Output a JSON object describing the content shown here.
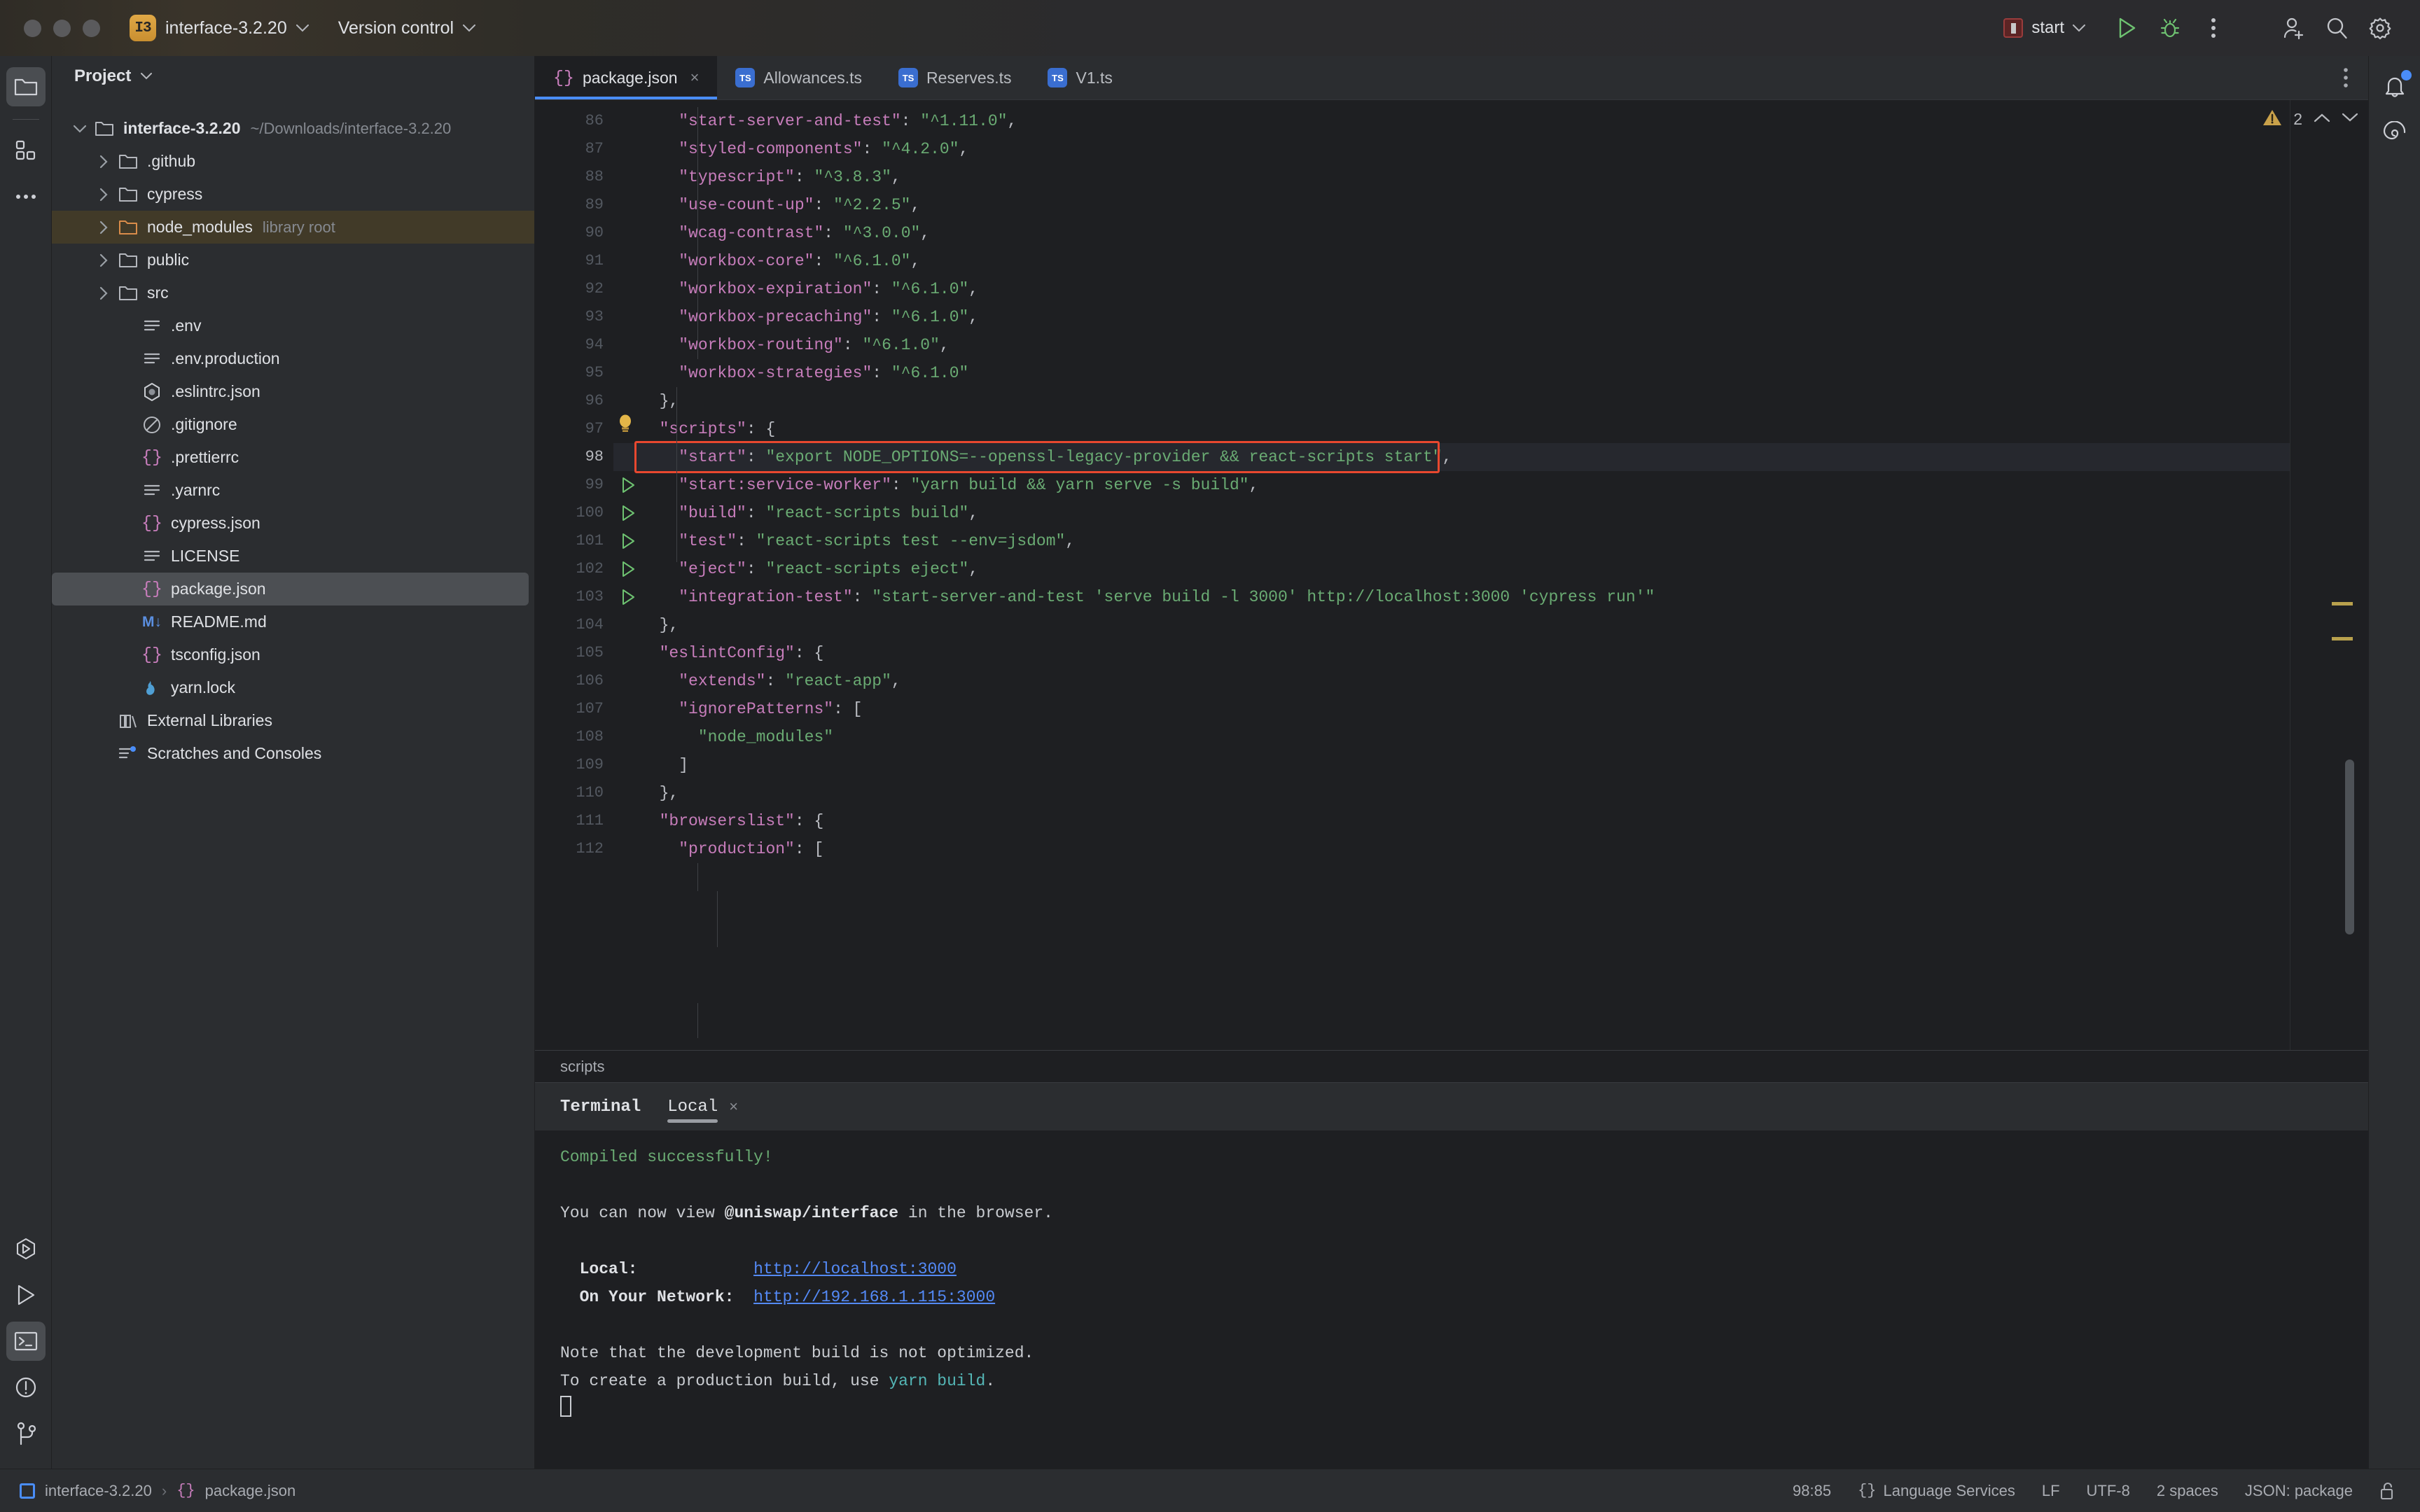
{
  "titlebar": {
    "project_badge": "I3",
    "project_name": "interface-3.2.20",
    "vcs_label": "Version control",
    "run_config": "start",
    "icons": [
      "run-icon",
      "debug-icon",
      "more-actions-icon",
      "add-user-icon",
      "search-icon",
      "settings-gear-icon"
    ]
  },
  "left_rail": {
    "items": [
      {
        "name": "project-tool-window",
        "icon": "folder-icon",
        "active": true
      },
      {
        "name": "structure-tool-window",
        "icon": "grid-modules-icon",
        "active": false
      },
      {
        "name": "more-tool-windows",
        "icon": "ellipsis-icon",
        "active": false
      }
    ],
    "bottom_items": [
      {
        "name": "services-tool-window",
        "icon": "hexagon-play-icon",
        "active": false
      },
      {
        "name": "run-tool-window",
        "icon": "play-triangle-icon",
        "active": false
      },
      {
        "name": "terminal-tool-window",
        "icon": "terminal-prompt-icon",
        "active": true
      },
      {
        "name": "problems-tool-window",
        "icon": "exclamation-circle-icon",
        "active": false
      },
      {
        "name": "version-control-tool-window",
        "icon": "git-branch-icon",
        "active": false
      }
    ]
  },
  "project_panel": {
    "title": "Project",
    "tree": [
      {
        "label": "interface-3.2.20",
        "hint": "~/Downloads/interface-3.2.20",
        "icon": "folder-icon",
        "indent": 0,
        "twisty": "down",
        "bold": true,
        "selected": ""
      },
      {
        "label": ".github",
        "hint": "",
        "icon": "folder-icon",
        "indent": 1,
        "twisty": "right",
        "bold": false,
        "selected": ""
      },
      {
        "label": "cypress",
        "hint": "",
        "icon": "folder-icon",
        "indent": 1,
        "twisty": "right",
        "bold": false,
        "selected": ""
      },
      {
        "label": "node_modules",
        "hint": "library root",
        "icon": "folder-orange-icon",
        "indent": 1,
        "twisty": "right",
        "bold": false,
        "selected": "amber"
      },
      {
        "label": "public",
        "hint": "",
        "icon": "folder-icon",
        "indent": 1,
        "twisty": "right",
        "bold": false,
        "selected": ""
      },
      {
        "label": "src",
        "hint": "",
        "icon": "folder-icon",
        "indent": 1,
        "twisty": "right",
        "bold": false,
        "selected": ""
      },
      {
        "label": ".env",
        "hint": "",
        "icon": "text-file-icon",
        "indent": 2,
        "twisty": "",
        "bold": false,
        "selected": ""
      },
      {
        "label": ".env.production",
        "hint": "",
        "icon": "text-file-icon",
        "indent": 2,
        "twisty": "",
        "bold": false,
        "selected": ""
      },
      {
        "label": ".eslintrc.json",
        "hint": "",
        "icon": "eslint-icon",
        "indent": 2,
        "twisty": "",
        "bold": false,
        "selected": ""
      },
      {
        "label": ".gitignore",
        "hint": "",
        "icon": "gitignore-icon",
        "indent": 2,
        "twisty": "",
        "bold": false,
        "selected": ""
      },
      {
        "label": ".prettierrc",
        "hint": "",
        "icon": "json-braces-icon",
        "indent": 2,
        "twisty": "",
        "bold": false,
        "selected": ""
      },
      {
        "label": ".yarnrc",
        "hint": "",
        "icon": "text-file-icon",
        "indent": 2,
        "twisty": "",
        "bold": false,
        "selected": ""
      },
      {
        "label": "cypress.json",
        "hint": "",
        "icon": "json-braces-icon",
        "indent": 2,
        "twisty": "",
        "bold": false,
        "selected": ""
      },
      {
        "label": "LICENSE",
        "hint": "",
        "icon": "text-file-icon",
        "indent": 2,
        "twisty": "",
        "bold": false,
        "selected": ""
      },
      {
        "label": "package.json",
        "hint": "",
        "icon": "json-braces-icon",
        "indent": 2,
        "twisty": "",
        "bold": false,
        "selected": "grey"
      },
      {
        "label": "README.md",
        "hint": "",
        "icon": "markdown-icon",
        "indent": 2,
        "twisty": "",
        "bold": false,
        "selected": ""
      },
      {
        "label": "tsconfig.json",
        "hint": "",
        "icon": "json-braces-icon",
        "indent": 2,
        "twisty": "",
        "bold": false,
        "selected": ""
      },
      {
        "label": "yarn.lock",
        "hint": "",
        "icon": "yarn-cat-icon",
        "indent": 2,
        "twisty": "",
        "bold": false,
        "selected": ""
      },
      {
        "label": "External Libraries",
        "hint": "",
        "icon": "libraries-icon",
        "indent": 1,
        "twisty": "",
        "bold": false,
        "selected": ""
      },
      {
        "label": "Scratches and Consoles",
        "hint": "",
        "icon": "scratches-icon",
        "indent": 1,
        "twisty": "",
        "bold": false,
        "selected": ""
      }
    ]
  },
  "editor": {
    "tabs": [
      {
        "label": "package.json",
        "icon": "json-braces-icon",
        "active": true,
        "closable": true
      },
      {
        "label": "Allowances.ts",
        "icon": "ts-icon",
        "active": false,
        "closable": false
      },
      {
        "label": "Reserves.ts",
        "icon": "ts-icon",
        "active": false,
        "closable": false
      },
      {
        "label": "V1.ts",
        "icon": "ts-icon",
        "active": false,
        "closable": false
      }
    ],
    "warning_count": "2",
    "breadcrumb": "scripts",
    "current_line": 98,
    "highlight_line": 98,
    "first_line_number": 86,
    "lines": [
      {
        "n": 86,
        "indent": 4,
        "key": "\"start-server-and-test\"",
        "val": "\"^1.11.0\"",
        "comma": true,
        "raw": "",
        "gutter": ""
      },
      {
        "n": 87,
        "indent": 4,
        "key": "\"styled-components\"",
        "val": "\"^4.2.0\"",
        "comma": true,
        "raw": "",
        "gutter": ""
      },
      {
        "n": 88,
        "indent": 4,
        "key": "\"typescript\"",
        "val": "\"^3.8.3\"",
        "comma": true,
        "raw": "",
        "gutter": ""
      },
      {
        "n": 89,
        "indent": 4,
        "key": "\"use-count-up\"",
        "val": "\"^2.2.5\"",
        "comma": true,
        "raw": "",
        "gutter": ""
      },
      {
        "n": 90,
        "indent": 4,
        "key": "\"wcag-contrast\"",
        "val": "\"^3.0.0\"",
        "comma": true,
        "raw": "",
        "gutter": ""
      },
      {
        "n": 91,
        "indent": 4,
        "key": "\"workbox-core\"",
        "val": "\"^6.1.0\"",
        "comma": true,
        "raw": "",
        "gutter": ""
      },
      {
        "n": 92,
        "indent": 4,
        "key": "\"workbox-expiration\"",
        "val": "\"^6.1.0\"",
        "comma": true,
        "raw": "",
        "gutter": ""
      },
      {
        "n": 93,
        "indent": 4,
        "key": "\"workbox-precaching\"",
        "val": "\"^6.1.0\"",
        "comma": true,
        "raw": "",
        "gutter": ""
      },
      {
        "n": 94,
        "indent": 4,
        "key": "\"workbox-routing\"",
        "val": "\"^6.1.0\"",
        "comma": true,
        "raw": "",
        "gutter": ""
      },
      {
        "n": 95,
        "indent": 4,
        "key": "\"workbox-strategies\"",
        "val": "\"^6.1.0\"",
        "comma": false,
        "raw": "",
        "gutter": ""
      },
      {
        "n": 96,
        "indent": 2,
        "key": "",
        "val": "",
        "comma": false,
        "raw": "},",
        "gutter": ""
      },
      {
        "n": 97,
        "indent": 2,
        "key": "\"scripts\"",
        "val": "",
        "comma": false,
        "raw": "",
        "open": "{",
        "gutter": "bulb"
      },
      {
        "n": 98,
        "indent": 4,
        "key": "\"start\"",
        "val": "\"export NODE_OPTIONS=--openssl-legacy-provider && react-scripts start\"",
        "comma": true,
        "raw": "",
        "gutter": "run"
      },
      {
        "n": 99,
        "indent": 4,
        "key": "\"start:service-worker\"",
        "val": "\"yarn build && yarn serve -s build\"",
        "comma": true,
        "raw": "",
        "gutter": "run"
      },
      {
        "n": 100,
        "indent": 4,
        "key": "\"build\"",
        "val": "\"react-scripts build\"",
        "comma": true,
        "raw": "",
        "gutter": "run"
      },
      {
        "n": 101,
        "indent": 4,
        "key": "\"test\"",
        "val": "\"react-scripts test --env=jsdom\"",
        "comma": true,
        "raw": "",
        "gutter": "run"
      },
      {
        "n": 102,
        "indent": 4,
        "key": "\"eject\"",
        "val": "\"react-scripts eject\"",
        "comma": true,
        "raw": "",
        "gutter": "run"
      },
      {
        "n": 103,
        "indent": 4,
        "key": "\"integration-test\"",
        "val": "\"start-server-and-test 'serve build -l 3000' http://localhost:3000 'cypress run'\"",
        "comma": false,
        "raw": "",
        "gutter": "run"
      },
      {
        "n": 104,
        "indent": 2,
        "key": "",
        "val": "",
        "comma": false,
        "raw": "},",
        "gutter": ""
      },
      {
        "n": 105,
        "indent": 2,
        "key": "\"eslintConfig\"",
        "val": "",
        "comma": false,
        "raw": "",
        "open": "{",
        "gutter": ""
      },
      {
        "n": 106,
        "indent": 4,
        "key": "\"extends\"",
        "val": "\"react-app\"",
        "comma": true,
        "raw": "",
        "gutter": ""
      },
      {
        "n": 107,
        "indent": 4,
        "key": "\"ignorePatterns\"",
        "val": "",
        "comma": false,
        "raw": "",
        "open": "[",
        "gutter": ""
      },
      {
        "n": 108,
        "indent": 6,
        "key": "",
        "val": "\"node_modules\"",
        "comma": false,
        "raw": "",
        "gutter": ""
      },
      {
        "n": 109,
        "indent": 4,
        "key": "",
        "val": "",
        "comma": false,
        "raw": "]",
        "gutter": ""
      },
      {
        "n": 110,
        "indent": 2,
        "key": "",
        "val": "",
        "comma": false,
        "raw": "},",
        "gutter": ""
      },
      {
        "n": 111,
        "indent": 2,
        "key": "\"browserslist\"",
        "val": "",
        "comma": false,
        "raw": "",
        "open": "{",
        "gutter": ""
      },
      {
        "n": 112,
        "indent": 4,
        "key": "\"production\"",
        "val": "",
        "comma": false,
        "raw": "",
        "open": "[",
        "gutter": ""
      }
    ]
  },
  "terminal": {
    "title": "Terminal",
    "local_tab": "Local",
    "close_glyph": "×",
    "lines": [
      {
        "type": "green",
        "text": "Compiled successfully!"
      },
      {
        "type": "blank",
        "text": ""
      },
      {
        "type": "mixed-bold",
        "pre": "You can now view ",
        "bold": "@uniswap/interface",
        "post": " in the browser."
      },
      {
        "type": "blank",
        "text": ""
      },
      {
        "type": "link",
        "label": "  Local:",
        "pad": "            ",
        "url": "http://localhost:3000"
      },
      {
        "type": "link",
        "label": "  On Your Network:",
        "pad": "  ",
        "url": "http://192.168.1.115:3000"
      },
      {
        "type": "blank",
        "text": ""
      },
      {
        "type": "plain",
        "text": "Note that the development build is not optimized."
      },
      {
        "type": "mixed-cyan",
        "pre": "To create a production build, use ",
        "cyan": "yarn build",
        "post": "."
      },
      {
        "type": "cursor",
        "text": ""
      }
    ]
  },
  "right_rail": {
    "items": [
      {
        "name": "notifications",
        "icon": "bell-icon",
        "badge": true
      },
      {
        "name": "ai-assistant",
        "icon": "spiral-icon",
        "badge": false
      }
    ]
  },
  "statusbar": {
    "breadcrumb_project": "interface-3.2.20",
    "breadcrumb_sep": "›",
    "breadcrumb_file": "package.json",
    "caret": "98:85",
    "language_services": "Language Services",
    "line_sep": "LF",
    "encoding": "UTF-8",
    "indent": "2 spaces",
    "schema": "JSON: package",
    "lock_icon": "unlocked-padlock-icon"
  },
  "colors": {
    "accent_blue": "#4a8df8",
    "json_key": "#c77dbb",
    "json_string": "#6aab73",
    "error_box": "#e8482f",
    "warning": "#b8a04d",
    "selection_amber": "#413a28",
    "panel_bg": "#2b2d30",
    "editor_bg": "#1e1f22"
  }
}
